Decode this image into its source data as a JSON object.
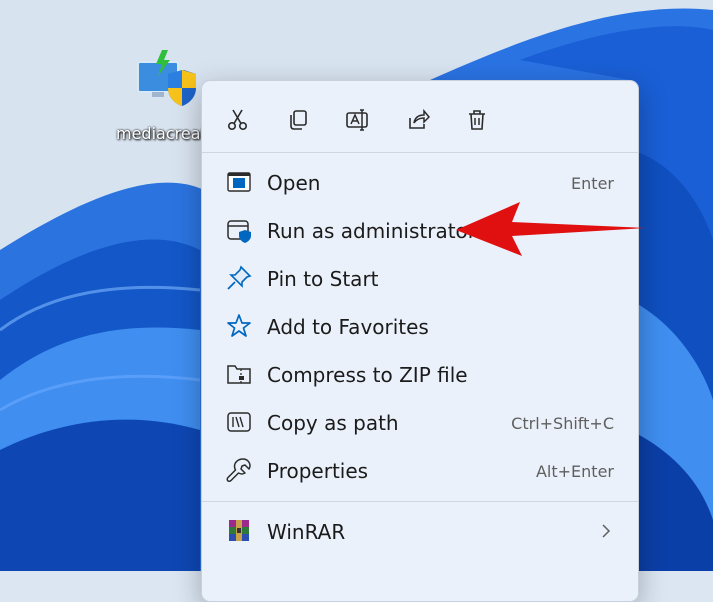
{
  "desktop": {
    "icon_name": "installer-shield-icon",
    "label": "mediacreat"
  },
  "toolbar": [
    {
      "name": "cut",
      "icon": "scissors-icon"
    },
    {
      "name": "copy",
      "icon": "copy-icon"
    },
    {
      "name": "rename",
      "icon": "rename-icon"
    },
    {
      "name": "share",
      "icon": "share-icon"
    },
    {
      "name": "delete",
      "icon": "trash-icon"
    }
  ],
  "menu": {
    "items": [
      {
        "label": "Open",
        "shortcut": "Enter",
        "icon": "open-window-icon"
      },
      {
        "label": "Run as administrator",
        "shortcut": "",
        "icon": "admin-shield-icon"
      },
      {
        "label": "Pin to Start",
        "shortcut": "",
        "icon": "pin-icon"
      },
      {
        "label": "Add to Favorites",
        "shortcut": "",
        "icon": "star-icon"
      },
      {
        "label": "Compress to ZIP file",
        "shortcut": "",
        "icon": "zip-folder-icon"
      },
      {
        "label": "Copy as path",
        "shortcut": "Ctrl+Shift+C",
        "icon": "path-icon"
      },
      {
        "label": "Properties",
        "shortcut": "Alt+Enter",
        "icon": "wrench-icon"
      },
      {
        "label": "WinRAR",
        "shortcut": "",
        "icon": "winrar-icon",
        "has_submenu": true
      }
    ]
  },
  "annotation": {
    "type": "arrow",
    "color": "#e01010",
    "points_to": "Run as administrator"
  },
  "colors": {
    "menu_bg": "#ebf1fa",
    "accent": "#0067c0",
    "wallpaper": "#1a5fd6"
  }
}
